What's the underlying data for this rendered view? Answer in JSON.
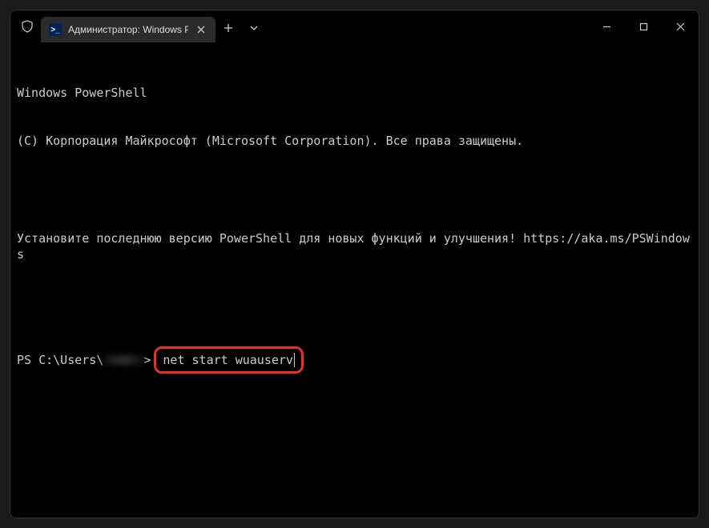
{
  "tab": {
    "title": "Администратор: Windows Po",
    "icon_text": ">_"
  },
  "terminal": {
    "line1": "Windows PowerShell",
    "line2": "(C) Корпорация Майкрософт (Microsoft Corporation). Все права защищены.",
    "line3": "Установите последнюю версию PowerShell для новых функций и улучшения! https://aka.ms/PSWindows",
    "prompt_prefix": "PS C:\\Users\\",
    "prompt_suffix": ">",
    "command": "net start wuauserv"
  }
}
